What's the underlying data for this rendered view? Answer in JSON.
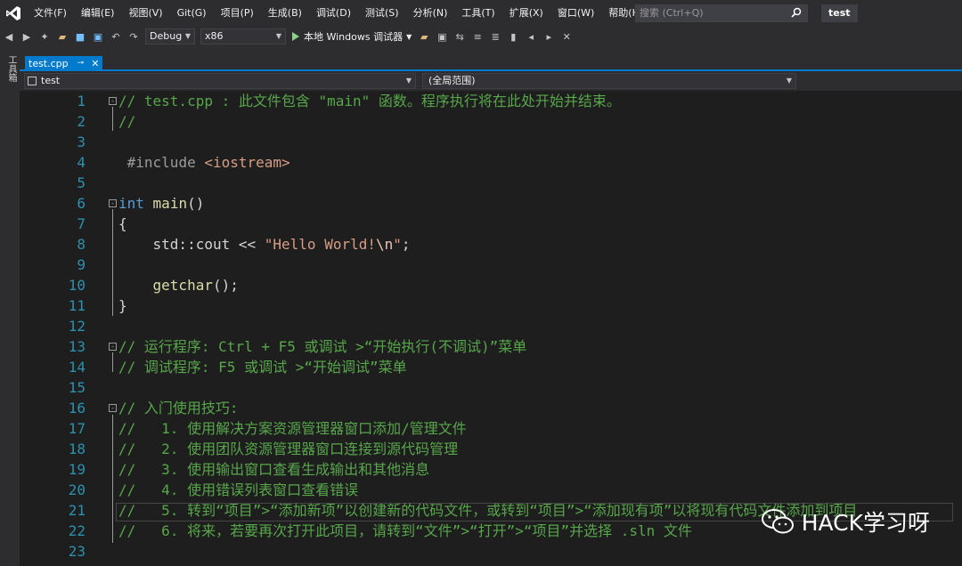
{
  "menu": {
    "items": [
      "文件(F)",
      "编辑(E)",
      "视图(V)",
      "Git(G)",
      "项目(P)",
      "生成(B)",
      "调试(D)",
      "测试(S)",
      "分析(N)",
      "工具(T)",
      "扩展(X)",
      "窗口(W)",
      "帮助(H)"
    ],
    "search_placeholder": "搜索 (Ctrl+Q)",
    "solution_name": "test"
  },
  "toolbar": {
    "config": "Debug",
    "platform": "x86",
    "run_label": "本地 Windows 调试器"
  },
  "side_toolbox_label": "工具箱",
  "tab": {
    "filename": "test.cpp"
  },
  "navbar": {
    "project": "test",
    "scope": "(全局范围)"
  },
  "code": {
    "line_numbers": [
      "1",
      "2",
      "3",
      "4",
      "5",
      "6",
      "7",
      "8",
      "9",
      "10",
      "11",
      "12",
      "13",
      "14",
      "15",
      "16",
      "17",
      "18",
      "19",
      "20",
      "21",
      "22",
      "23"
    ],
    "l1": "// test.cpp : 此文件包含 \"main\" 函数。程序执行将在此处开始并结束。",
    "l2": "//",
    "l4_directive": "#include",
    "l4_header": "<iostream>",
    "l6_kw": "int",
    "l6_fn": "main",
    "l6_rest": "()",
    "l7": "{",
    "l8_pre": "    std::cout << ",
    "l8_str": "\"Hello World!",
    "l8_esc": "\\n",
    "l8_end": "\"",
    "l8_semi": ";",
    "l10_fn": "    getchar",
    "l10_rest": "();",
    "l11": "}",
    "l13": "// 运行程序: Ctrl + F5 或调试 >“开始执行(不调试)”菜单",
    "l14": "// 调试程序: F5 或调试 >“开始调试”菜单",
    "l16": "// 入门使用技巧:",
    "l17": "//   1. 使用解决方案资源管理器窗口添加/管理文件",
    "l18": "//   2. 使用团队资源管理器窗口连接到源代码管理",
    "l19": "//   3. 使用输出窗口查看生成输出和其他消息",
    "l20": "//   4. 使用错误列表窗口查看错误",
    "l21": "//   5. 转到“项目”>“添加新项”以创建新的代码文件，或转到“项目”>“添加现有项”以将现有代码文件添加到项目",
    "l22": "//   6. 将来，若要再次打开此项目，请转到“文件”>“打开”>“项目”并选择 .sln 文件"
  },
  "watermark": "HACK学习呀",
  "colors": {
    "accent": "#007acc",
    "comment": "#57a64a",
    "keyword": "#569cd6",
    "string": "#d69d85",
    "line_number": "#2b91af"
  }
}
